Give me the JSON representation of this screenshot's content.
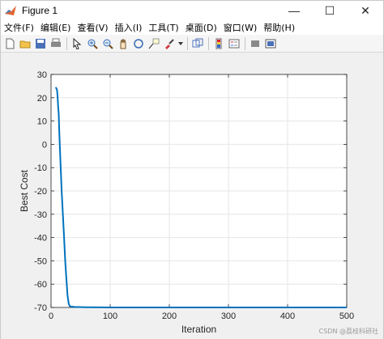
{
  "window": {
    "title": "Figure 1",
    "controls": [
      "—",
      "☐",
      "✕"
    ]
  },
  "menu": [
    "文件(F)",
    "编辑(E)",
    "查看(V)",
    "插入(I)",
    "工具(T)",
    "桌面(D)",
    "窗口(W)",
    "帮助(H)"
  ],
  "toolbar": {
    "icons": [
      "new-figure-icon",
      "open-file-icon",
      "save-icon",
      "print-icon",
      "pointer-icon",
      "zoom-in-icon",
      "zoom-out-icon",
      "pan-icon",
      "rotate-3d-icon",
      "data-cursor-icon",
      "brush-icon",
      "link-plot-icon",
      "colorbar-icon",
      "legend-icon",
      "hide-plot-tools-icon",
      "show-plot-tools-icon"
    ]
  },
  "watermark": "CSDN @荔枝科研社",
  "chart_data": {
    "type": "line",
    "title": "",
    "xlabel": "Iteration",
    "ylabel": "Best Cost",
    "xlim": [
      0,
      500
    ],
    "ylim": [
      -70,
      30
    ],
    "xticks": [
      0,
      100,
      200,
      300,
      400,
      500
    ],
    "yticks": [
      -70,
      -60,
      -50,
      -40,
      -30,
      -20,
      -10,
      0,
      10,
      20,
      30
    ],
    "grid": true,
    "line_color": "#0072bd",
    "series": [
      {
        "x": [
          8,
          10,
          11,
          12,
          13,
          14,
          16,
          18,
          20,
          22,
          24,
          26,
          28,
          30,
          32,
          40,
          60,
          100,
          200,
          300,
          400,
          500
        ],
        "y": [
          24.5,
          23.5,
          21.0,
          16.0,
          13.0,
          5.0,
          -8.0,
          -20.0,
          -30.0,
          -40.0,
          -50.0,
          -58.0,
          -65.0,
          -68.5,
          -69.6,
          -69.8,
          -69.9,
          -70.0,
          -70.0,
          -70.0,
          -70.0,
          -70.0
        ]
      }
    ]
  }
}
